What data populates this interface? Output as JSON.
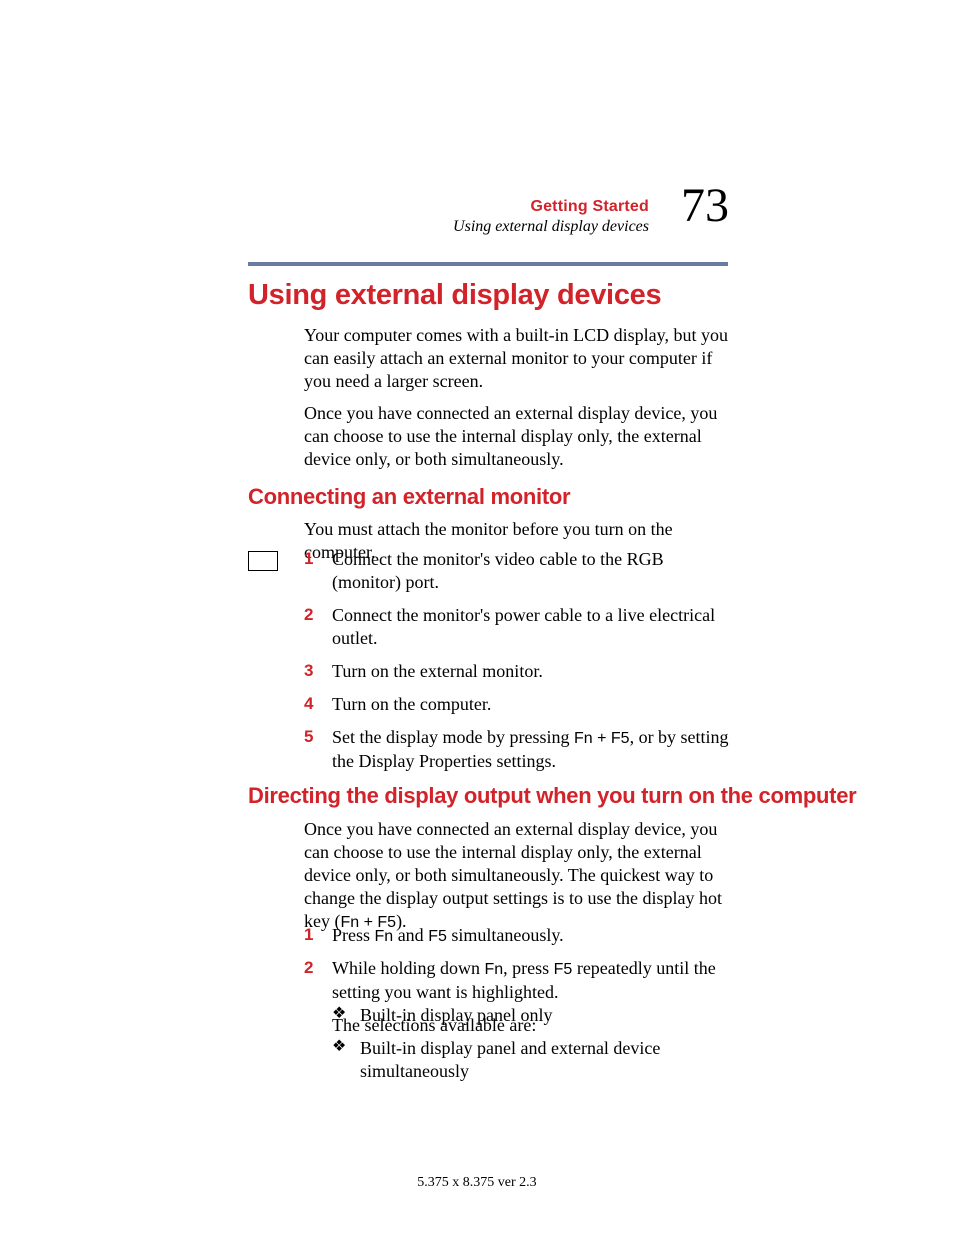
{
  "header": {
    "chapter": "Getting Started",
    "section": "Using external display devices",
    "page_number": "73"
  },
  "h1": "Using external display devices",
  "intro_p1": "Your computer comes with a built-in LCD display, but you can easily attach an external monitor to your computer if you need a larger screen.",
  "intro_p2": "Once you have connected an external display device, you can choose to use the internal display only, the external device only, or both simultaneously.",
  "sec_a": {
    "heading": "Connecting an external monitor",
    "lead": "You must attach the monitor before you turn on the computer.",
    "steps": [
      "Connect the monitor's video cable to the RGB (monitor) port.",
      "Connect the monitor's power cable to a live electrical outlet.",
      "Turn on the external monitor.",
      "Turn on the computer."
    ],
    "step5_pre": "Set the display mode by pressing ",
    "step5_key": "Fn + F5",
    "step5_post": ", or by setting the Display Properties settings."
  },
  "sec_b": {
    "heading": "Directing the display output when you turn on the computer",
    "lead_pre": "Once you have connected an external display device, you can choose to use the internal display only, the external device only, or both simultaneously. The quickest way to change the display output settings is to use the display hot key (",
    "lead_key": "Fn + F5",
    "lead_post": ").",
    "step1_pre": "Press ",
    "step1_k1": "Fn",
    "step1_mid": " and ",
    "step1_k2": "F5",
    "step1_post": " simultaneously.",
    "step2_pre": "While holding down ",
    "step2_k1": "Fn",
    "step2_mid": ", press ",
    "step2_k2": "F5",
    "step2_post": " repeatedly until the setting you want is highlighted.",
    "sub": "The selections available are:",
    "bullets": [
      "Built-in display panel only",
      "Built-in display panel and external device simultaneously"
    ]
  },
  "footer": "5.375 x 8.375 ver 2.3",
  "bullet_glyph": "❖"
}
